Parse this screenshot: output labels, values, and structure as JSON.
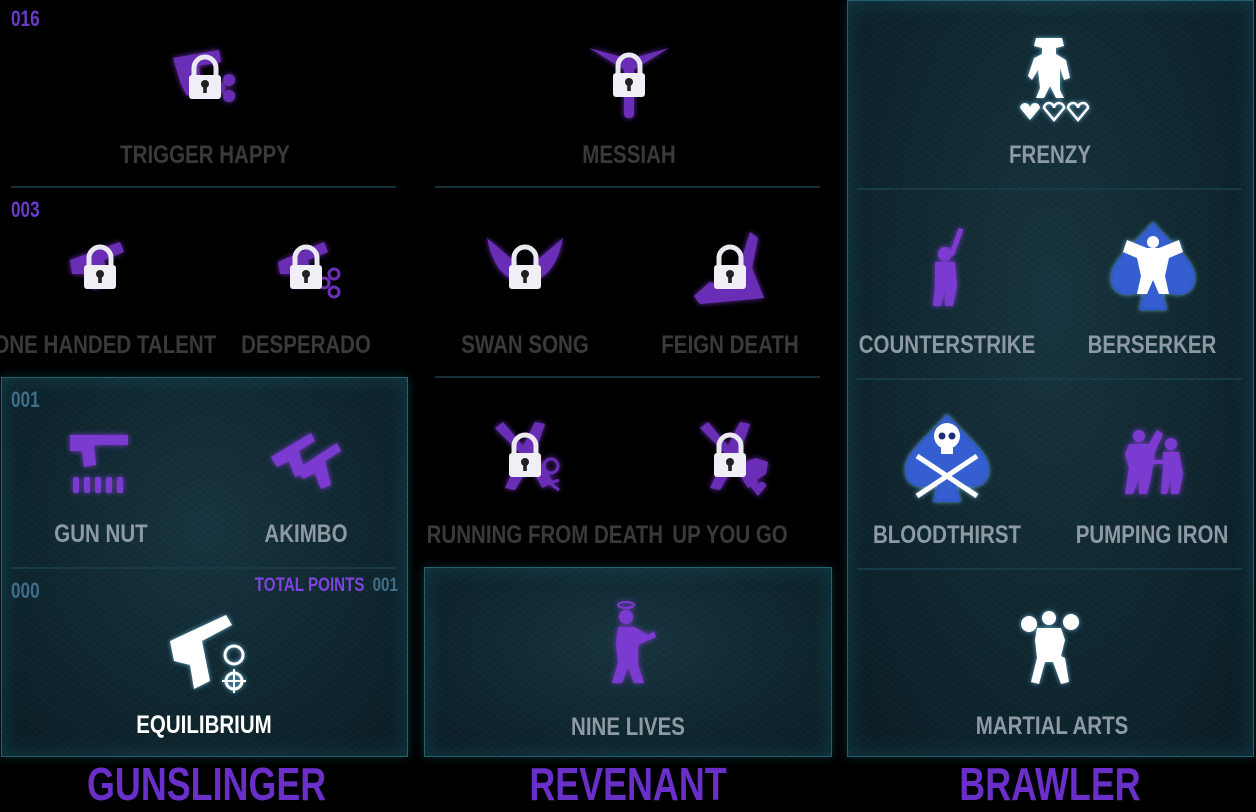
{
  "counters": {
    "gunslinger_tier4": "016",
    "gunslinger_tier3": "003",
    "gunslinger_tier2": "001",
    "gunslinger_tier1": "000"
  },
  "total_points": {
    "label": "TOTAL POINTS",
    "value": "001"
  },
  "perks": {
    "trigger_happy": "TRIGGER HAPPY",
    "messiah": "MESSIAH",
    "frenzy": "FRENZY",
    "one_handed_talent": "ONE HANDED TALENT",
    "desperado": "DESPERADO",
    "swan_song": "SWAN SONG",
    "feign_death": "FEIGN DEATH",
    "counterstrike": "COUNTERSTRIKE",
    "berserker": "BERSERKER",
    "gun_nut": "GUN NUT",
    "akimbo": "AKIMBO",
    "running_from_death": "RUNNING FROM DEATH",
    "up_you_go": "UP YOU GO",
    "bloodthirst": "BLOODTHIRST",
    "pumping_iron": "PUMPING IRON",
    "equilibrium": "EQUILIBRIUM",
    "nine_lives": "NINE LIVES",
    "martial_arts": "MARTIAL ARTS"
  },
  "trees": {
    "gunslinger": "GUNSLINGER",
    "revenant": "REVENANT",
    "brawler": "BRAWLER"
  },
  "colors": {
    "locked_text": "#3a3a3c",
    "available_text": "#8e9aa3",
    "owned_text": "#ffffff",
    "accent_purple": "#6a2fc8",
    "panel_teal": "#0f2730"
  }
}
